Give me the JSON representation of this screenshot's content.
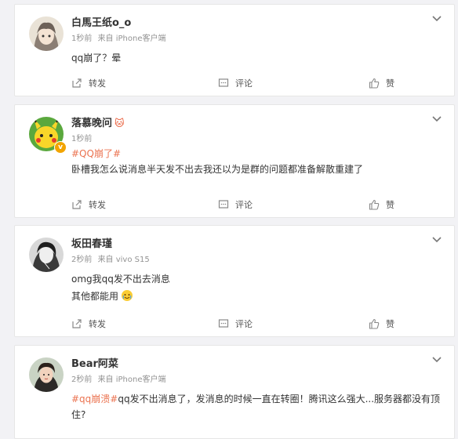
{
  "comments": [
    {
      "name": "白馬王纸o_o",
      "time": "1秒前",
      "source": "来自 iPhone客户端",
      "text_before_topic": "",
      "topic": "",
      "text": "qq崩了？晕",
      "line2": "",
      "icons": {
        "avatar": "anime-avatar",
        "menu": "chevron-down-icon"
      }
    },
    {
      "name": "落慕晚问",
      "name_emoji": "🐱",
      "time": "1秒前",
      "source": "",
      "topic": "#QQ崩了#",
      "text": "卧槽我怎么说消息半天发不出去我还以为是群的问题都准备解散重建了",
      "line2": "",
      "verified": "v",
      "icons": {
        "avatar": "pikachu-avatar",
        "menu": "chevron-down-icon"
      }
    },
    {
      "name": "坂田春瑾",
      "time": "2秒前",
      "source": "来自 vivo S15",
      "topic": "",
      "text": "omg我qq发不出去消息",
      "line2": "其他都能用",
      "icons": {
        "avatar": "sketch-avatar",
        "menu": "chevron-down-icon",
        "line2_emoji": "crying-laugh-emoji"
      }
    },
    {
      "name": "Bear阿菜",
      "time": "2秒前",
      "source": "来自 iPhone客户端",
      "topic": "#qq崩溃#",
      "text": "qq发不出消息了，发消息的时候一直在转圈！腾讯这么强大...服务器都没有顶",
      "line2": "住?",
      "icons": {
        "avatar": "photo-avatar",
        "menu": "chevron-down-icon"
      }
    }
  ],
  "actions": {
    "repost": "转发",
    "comment": "评论",
    "like": "赞"
  },
  "colors": {
    "topic": "#eb7350",
    "meta": "#939393",
    "background": "#f2f2f5"
  }
}
